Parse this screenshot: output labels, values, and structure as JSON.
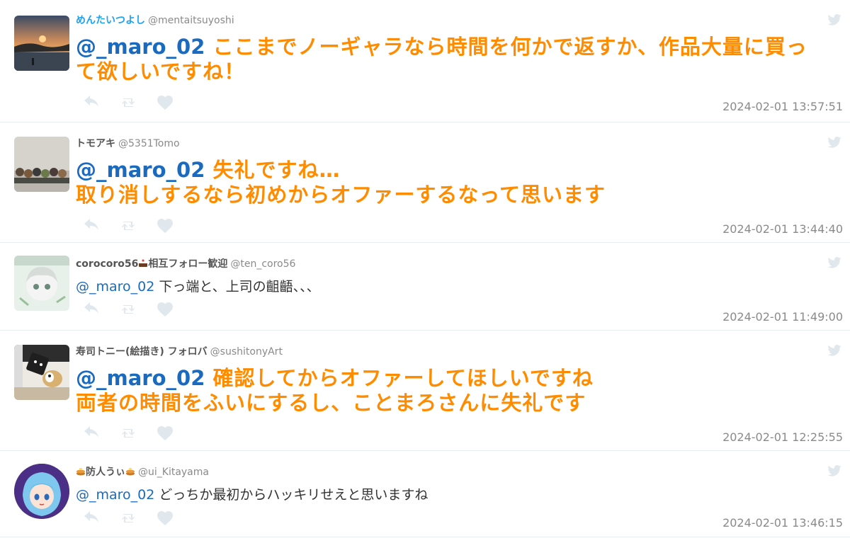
{
  "tweets": [
    {
      "name": "めんたいつよし",
      "handle": "@mentaitsuyoshi",
      "mention": "@_maro_02",
      "text_lines": [
        "ここまでノーギャラなら時間を何かで返すか、作品大量に買っ",
        "て欲しいですね！"
      ],
      "timestamp": "2024-02-01 13:57:51",
      "avatar": "sunset-avatar"
    },
    {
      "name": "トモアキ",
      "handle": "@5351Tomo",
      "mention": "@_maro_02",
      "text_lines": [
        "失礼ですね…",
        "取り消しするなら初めからオファーするなって思います"
      ],
      "timestamp": "2024-02-01 13:44:40",
      "avatar": "figures-avatar"
    },
    {
      "name": "corocoro56",
      "name_suffix": "相互フォロー歓迎",
      "handle": "@ten_coro56",
      "mention": "@_maro_02",
      "text": "下っ端と、上司の齟齬、、、",
      "timestamp": "2024-02-01 11:49:00",
      "avatar": "anime-avatar"
    },
    {
      "name": "寿司トニー(絵描き) フォロバ",
      "handle": "@sushitonyArt",
      "mention": "@_maro_02",
      "text_lines": [
        "確認してからオファーしてほしいですね",
        "両者の時間をふいにするし、ことまろさんに失礼です"
      ],
      "timestamp": "2024-02-01 12:25:55",
      "avatar": "dog-avatar"
    },
    {
      "name": "防人うぃ",
      "handle": "@ui_Kitayama",
      "mention": "@_maro_02",
      "text": "どっちか最初からハッキリせえと思いますね",
      "timestamp": "2024-02-01 13:46:15",
      "avatar": "blue-hair-avatar"
    }
  ],
  "icons": {
    "reply": "reply-icon",
    "retweet": "retweet-icon",
    "like": "heart-icon",
    "bird": "twitter-bird-icon"
  },
  "colors": {
    "mention": "#1a6bbf",
    "highlight_text": "#ff8c00",
    "name_link": "#1da1f2",
    "muted": "#8a8a8a"
  }
}
